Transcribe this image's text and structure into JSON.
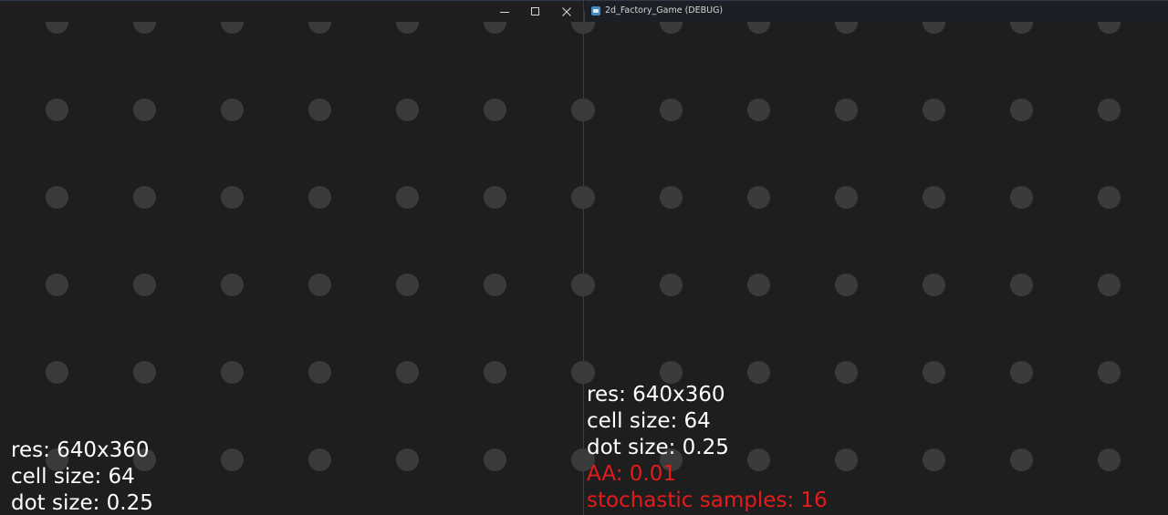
{
  "window": {
    "title": "2d_Factory_Game (DEBUG)",
    "controls": {
      "minimize_icon": "minimize-icon",
      "maximize_icon": "maximize-icon",
      "close_icon": "close-icon"
    },
    "app_icon": "godot-app-icon"
  },
  "colors": {
    "background": "#1e1e1e",
    "dot": "#3b3b3b",
    "overlay_text": "#ffffff",
    "overlay_warning": "#e31b1b",
    "titlebar": "#1c1f26"
  },
  "left_view": {
    "overlay": {
      "res": "res: 640x360",
      "cell_size": "cell size: 64",
      "dot_size": "dot size: 0.25"
    }
  },
  "right_view": {
    "overlay": {
      "res": "res: 640x360",
      "cell_size": "cell size: 64",
      "dot_size": "dot size: 0.25",
      "aa": "AA: 0.01",
      "stochastic_samples": "stochastic samples: 16"
    }
  }
}
